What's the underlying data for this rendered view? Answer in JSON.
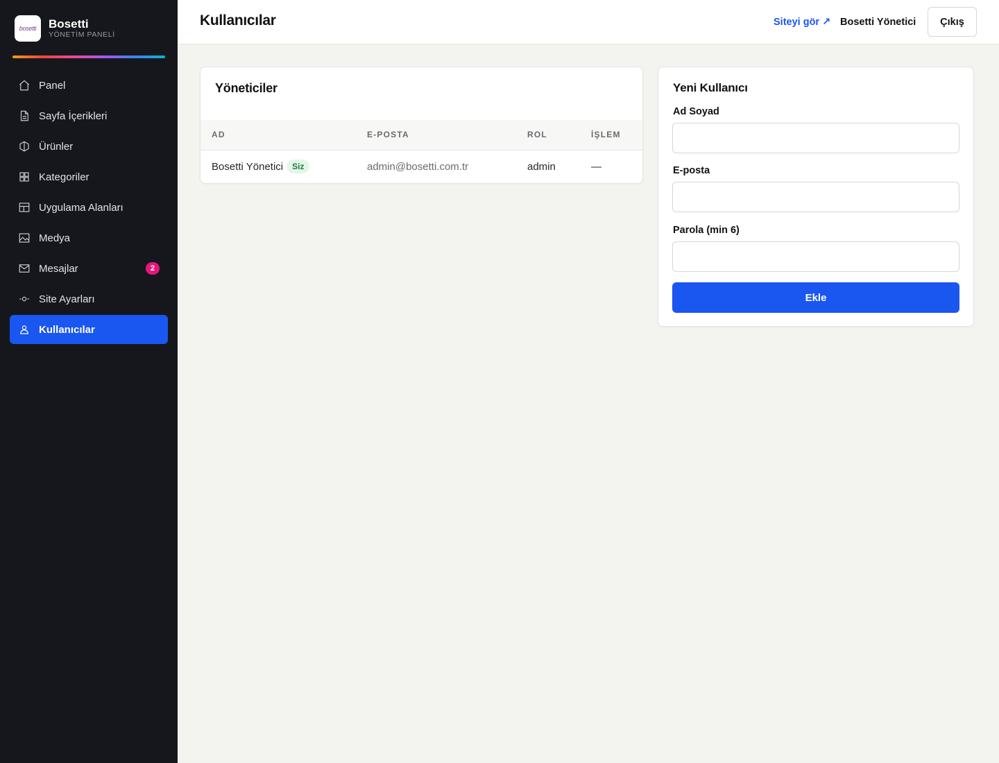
{
  "brand": {
    "logo_text": "bosetti",
    "name": "Bosetti",
    "subtitle": "YÖNETİM PANELİ"
  },
  "sidebar": {
    "items": [
      {
        "label": "Panel",
        "icon": "home-icon"
      },
      {
        "label": "Sayfa İçerikleri",
        "icon": "document-icon"
      },
      {
        "label": "Ürünler",
        "icon": "box-icon"
      },
      {
        "label": "Kategoriler",
        "icon": "grid-icon"
      },
      {
        "label": "Uygulama Alanları",
        "icon": "layout-icon"
      },
      {
        "label": "Medya",
        "icon": "image-icon"
      },
      {
        "label": "Mesajlar",
        "icon": "mail-icon",
        "badge": "2"
      },
      {
        "label": "Site Ayarları",
        "icon": "settings-icon"
      },
      {
        "label": "Kullanıcılar",
        "icon": "user-icon",
        "active": true
      }
    ],
    "badge_color": "#e5177b",
    "active_color": "#1a56f0"
  },
  "header": {
    "title": "Kullanıcılar",
    "site_link": "Siteyi gör ↗",
    "user_name": "Bosetti Yönetici",
    "logout_label": "Çıkış"
  },
  "admins": {
    "title": "Yöneticiler",
    "columns": [
      "AD",
      "E-POSTA",
      "ROL",
      "İŞLEM"
    ],
    "rows": [
      {
        "name": "Bosetti Yönetici",
        "badge": "Siz",
        "email": "admin@bosetti.com.tr",
        "role": "admin",
        "action": "—"
      }
    ]
  },
  "new_user": {
    "title": "Yeni Kullanıcı",
    "name_label": "Ad Soyad",
    "name_value": "",
    "email_label": "E-posta",
    "email_value": "",
    "password_label": "Parola (min 6)",
    "password_value": "",
    "submit_label": "Ekle"
  }
}
